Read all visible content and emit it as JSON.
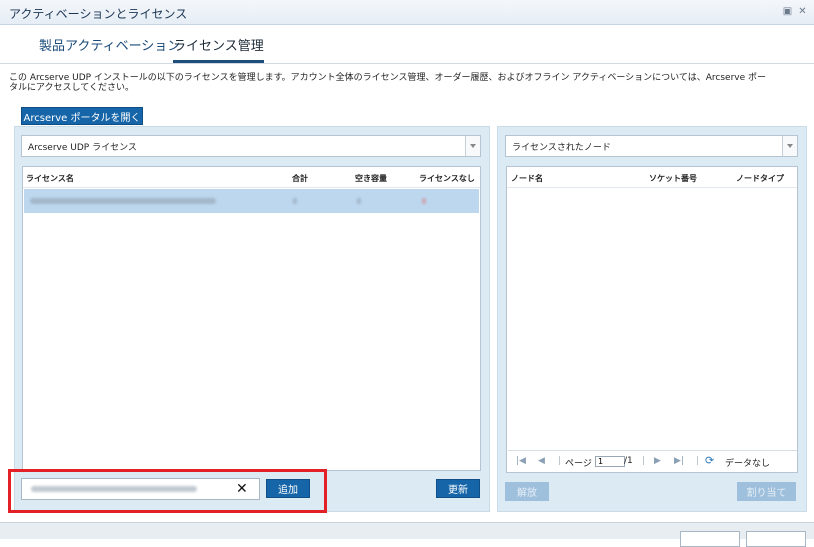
{
  "window": {
    "title": "アクティベーションとライセンス",
    "controls": [
      "restore-icon",
      "close-icon"
    ]
  },
  "tabs": [
    {
      "label": "製品アクティベーション",
      "active": false
    },
    {
      "label": "ライセンス管理",
      "active": true
    }
  ],
  "description": "この Arcserve UDP インストールの以下のライセンスを管理します。アカウント全体のライセンス管理、オーダー履歴、およびオフライン アクティベーションについては、Arcserve ポータルにアクセスしてください。",
  "portal_button": "Arcserve ポータルを開く",
  "left_panel": {
    "combo_value": "Arcserve UDP ライセンス",
    "columns": [
      "ライセンス名",
      "合計",
      "空き容量",
      "ライセンスなし"
    ],
    "refresh_button": "更新",
    "add_button": "追加",
    "clear_icon": "✕"
  },
  "right_panel": {
    "combo_value": "ライセンスされたノード",
    "columns": [
      "ノード名",
      "ソケット番号",
      "ノードタイプ"
    ],
    "pager": {
      "page_label": "ページ",
      "page_value": "1",
      "total": "/1",
      "status": "データなし"
    },
    "release_button": "解放",
    "assign_button": "割り当て"
  },
  "colors": {
    "accent": "#1565a8",
    "panel_bg": "#dcebf3",
    "highlight": "#e32026",
    "selected_row": "#bcd7ee"
  }
}
